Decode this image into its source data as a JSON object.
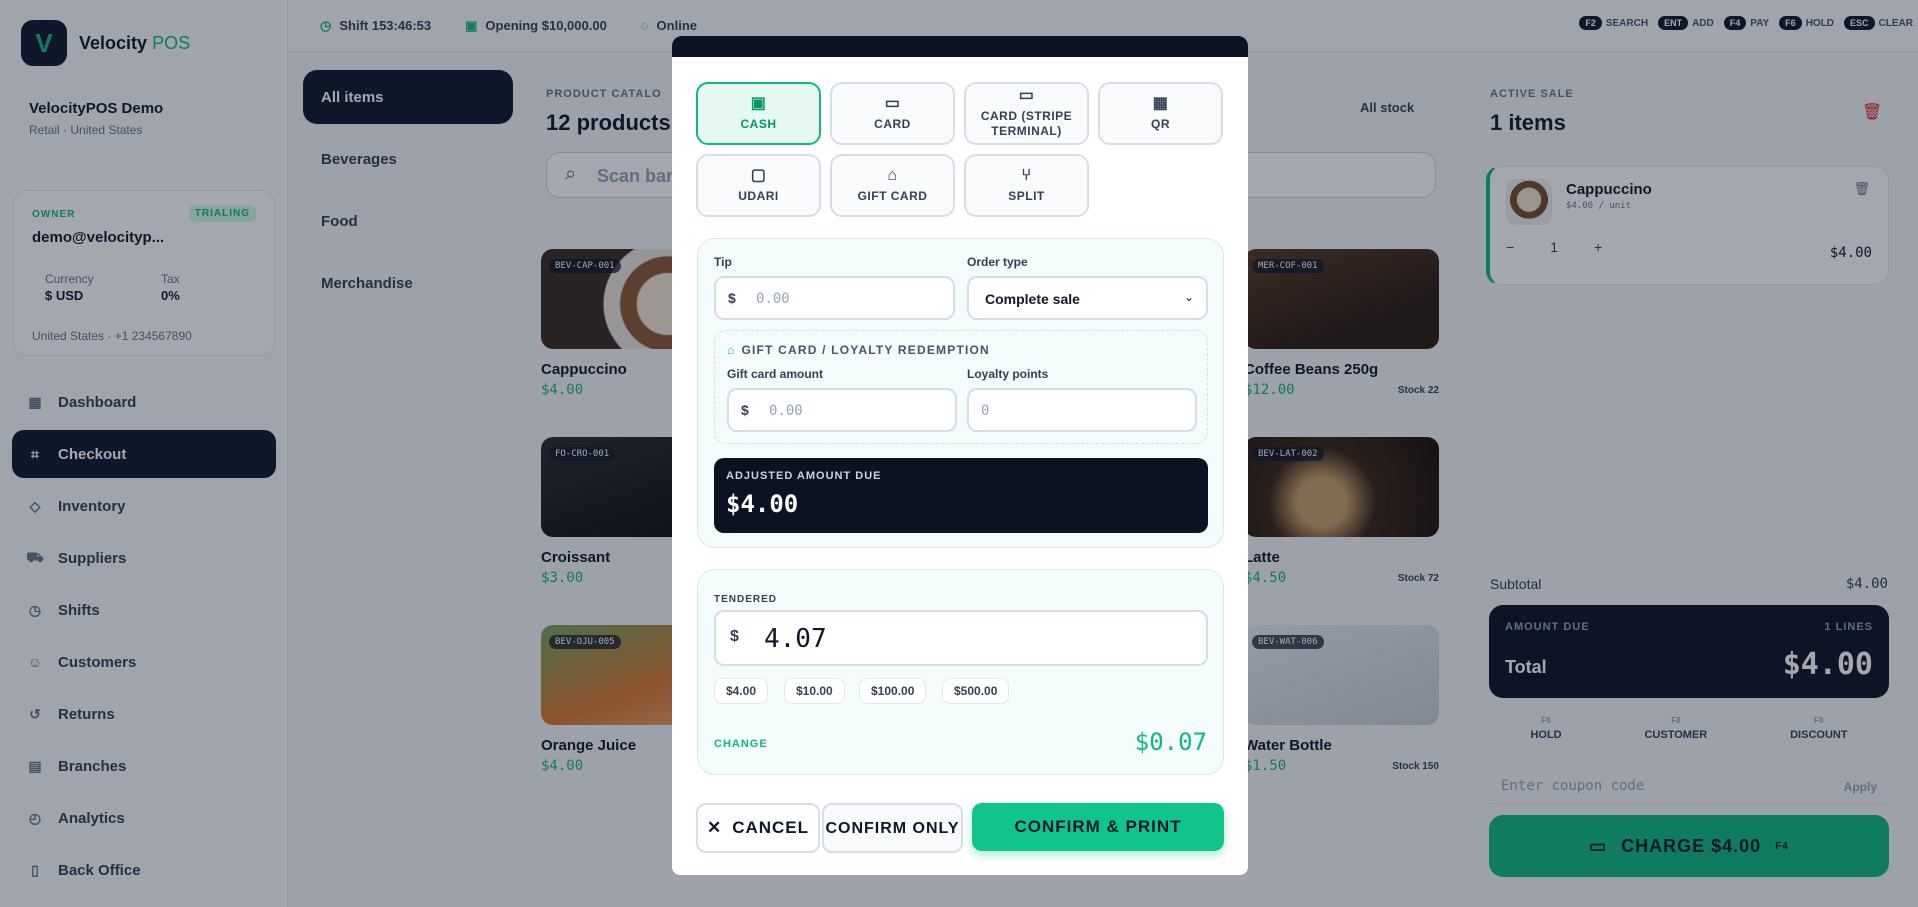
{
  "app": {
    "name": "Velocity",
    "name_accent": "POS",
    "logo_glyph": "V"
  },
  "org": {
    "name": "VelocityPOS Demo",
    "type": "Retail",
    "country": "United States"
  },
  "account": {
    "role": "OWNER",
    "status": "TRIALING",
    "email": "demo@velocityp...",
    "currency_label": "Currency",
    "currency": "$ USD",
    "tax_label": "Tax",
    "tax": "0%",
    "location": "United States",
    "phone": "+1 234567890"
  },
  "nav": [
    {
      "label": "Dashboard",
      "icon": "grid-icon",
      "glyph": "▦"
    },
    {
      "label": "Checkout",
      "icon": "scan-icon",
      "glyph": "⌗"
    },
    {
      "label": "Inventory",
      "icon": "box-icon",
      "glyph": "◇"
    },
    {
      "label": "Suppliers",
      "icon": "truck-icon",
      "glyph": "⛟"
    },
    {
      "label": "Shifts",
      "icon": "clock-icon",
      "glyph": "◷"
    },
    {
      "label": "Customers",
      "icon": "users-icon",
      "glyph": "☺"
    },
    {
      "label": "Returns",
      "icon": "undo-icon",
      "glyph": "↺"
    },
    {
      "label": "Branches",
      "icon": "building-icon",
      "glyph": "▤"
    },
    {
      "label": "Analytics",
      "icon": "chart-icon",
      "glyph": "◴"
    },
    {
      "label": "Back Office",
      "icon": "file-icon",
      "glyph": "▯"
    }
  ],
  "topbar": {
    "shift": "Shift 153:46:53",
    "opening": "Opening $10,000.00",
    "status": "Online"
  },
  "shortcuts": [
    {
      "key": "F2",
      "label": "SEARCH"
    },
    {
      "key": "ENT",
      "label": "ADD"
    },
    {
      "key": "F4",
      "label": "PAY"
    },
    {
      "key": "F6",
      "label": "HOLD"
    },
    {
      "key": "ESC",
      "label": "CLEAR"
    }
  ],
  "categories": [
    "All items",
    "Beverages",
    "Food",
    "Merchandise"
  ],
  "catalog": {
    "label": "PRODUCT CATALO",
    "count": "12 products",
    "filter": "All stock",
    "search_placeholder": "Scan bar",
    "search_key": "F2"
  },
  "products": [
    {
      "sku": "BEV-CAP-001",
      "name": "Cappuccino",
      "price": "$4.00",
      "stock": ""
    },
    {
      "sku": "MER-COF-001",
      "name": "Coffee Beans 250g",
      "price": "$12.00",
      "stock": "Stock 22"
    },
    {
      "sku": "FO-CRO-001",
      "name": "Croissant",
      "price": "$3.00",
      "stock": ""
    },
    {
      "sku": "BEV-LAT-002",
      "name": "Latte",
      "price": "$4.50",
      "stock": "Stock 72"
    },
    {
      "sku": "BEV-OJU-005",
      "name": "Orange Juice",
      "price": "$4.00",
      "stock": ""
    },
    {
      "sku": "BEV-WAT-006",
      "name": "Water Bottle",
      "price": "$1.50",
      "stock": "Stock 150"
    }
  ],
  "sale": {
    "label": "ACTIVE SALE",
    "count": "1 items",
    "line": {
      "name": "Cappuccino",
      "unit": "$4.00 / unit",
      "qty": "1",
      "amount": "$4.00"
    },
    "subtotal_label": "Subtotal",
    "subtotal": "$4.00",
    "due_label": "AMOUNT DUE",
    "lines": "1 LINES",
    "total_label": "Total",
    "total": "$4.00",
    "actions": [
      {
        "key": "F6",
        "label": "HOLD"
      },
      {
        "key": "F8",
        "label": "CUSTOMER"
      },
      {
        "key": "F9",
        "label": "DISCOUNT"
      }
    ],
    "coupon_placeholder": "Enter coupon code",
    "apply": "Apply",
    "charge": "CHARGE $4.00",
    "charge_key": "F4"
  },
  "modal": {
    "methods": [
      {
        "label": "CASH",
        "icon": "cash-icon",
        "glyph": "▣",
        "active": true
      },
      {
        "label": "CARD",
        "icon": "card-icon",
        "glyph": "▭"
      },
      {
        "label": "CARD (STRIPE TERMINAL)",
        "icon": "terminal-card-icon",
        "glyph": "▭"
      },
      {
        "label": "QR",
        "icon": "qr-icon",
        "glyph": "▦"
      },
      {
        "label": "UDARI",
        "icon": "wallet-icon",
        "glyph": "▢"
      },
      {
        "label": "GIFT CARD",
        "icon": "gift-icon",
        "glyph": "⌂"
      },
      {
        "label": "SPLIT",
        "icon": "split-icon",
        "glyph": "⑂"
      }
    ],
    "tip_label": "Tip",
    "tip_currency": "$",
    "tip_placeholder": "0.00",
    "order_type_label": "Order type",
    "order_type": "Complete sale",
    "gift_title": "GIFT CARD / LOYALTY REDEMPTION",
    "gift_amount_label": "Gift card amount",
    "gift_currency": "$",
    "gift_placeholder": "0.00",
    "loyalty_label": "Loyalty points",
    "loyalty_placeholder": "0",
    "adjusted_label": "ADJUSTED AMOUNT DUE",
    "adjusted": "$4.00",
    "tendered_label": "TENDERED",
    "tendered_currency": "$",
    "tendered": "4.07",
    "quick_amounts": [
      "$4.00",
      "$10.00",
      "$100.00",
      "$500.00"
    ],
    "change_label": "CHANGE",
    "change": "$0.07",
    "cancel": "CANCEL",
    "confirm_only": "CONFIRM ONLY",
    "confirm_print": "CONFIRM & PRINT"
  },
  "colors": {
    "accent": "#10b981",
    "dark": "#0b1222",
    "danger": "#dc2626"
  }
}
